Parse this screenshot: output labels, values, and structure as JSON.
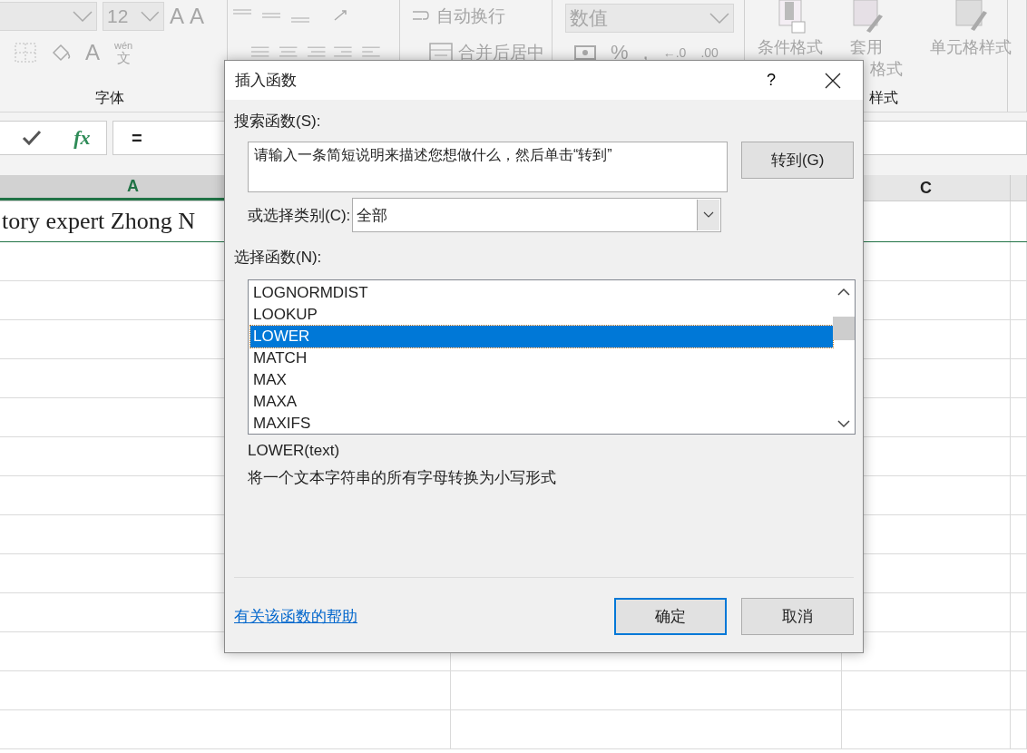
{
  "ribbon": {
    "font_size": "12",
    "grow_font": "A",
    "shrink_font": "A",
    "font_color": "A",
    "phonetic": {
      "top": "wén",
      "bottom": "文"
    },
    "wrap_text": "自动换行",
    "merge_center": "合并后居中",
    "number_format": "数值",
    "percent": "%",
    "comma": ",",
    "decimal_increase": "←.0",
    "decimal_decrease": ".00",
    "conditional_format": "条件格式",
    "table_format": [
      "套用",
      "格式"
    ],
    "cell_styles": "单元格样式",
    "font_group_label": "字体",
    "styles_group_label": "样式"
  },
  "formula_bar": {
    "fx": "fx",
    "formula": "="
  },
  "columns": [
    {
      "label": "A",
      "selected": true
    },
    {
      "label": "C",
      "selected": false
    }
  ],
  "cell_a1": "tory expert Zhong N",
  "dialog": {
    "title": "插入函数",
    "help": "?",
    "search_label": "搜索函数(S):",
    "search_value": "请输入一条简短说明来描述您想做什么，然后单击“转到”",
    "go_button": "转到(G)",
    "category_label": "或选择类别(C):",
    "category": "全部",
    "functions_label": "选择函数(N):",
    "functions": [
      {
        "name": "LOGNORMDIST",
        "selected": false
      },
      {
        "name": "LOOKUP",
        "selected": false
      },
      {
        "name": "LOWER",
        "selected": true
      },
      {
        "name": "MATCH",
        "selected": false
      },
      {
        "name": "MAX",
        "selected": false
      },
      {
        "name": "MAXA",
        "selected": false
      },
      {
        "name": "MAXIFS",
        "selected": false
      }
    ],
    "signature": "LOWER(text)",
    "description": "将一个文本字符串的所有字母转换为小写形式",
    "help_link": "有关该函数的帮助",
    "ok": "确定",
    "cancel": "取消"
  }
}
